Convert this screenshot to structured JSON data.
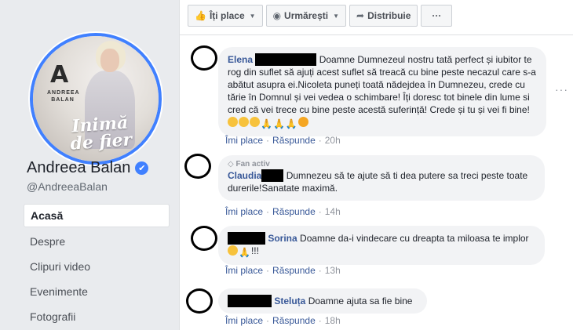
{
  "page": {
    "name": "Andreea Balan",
    "handle": "@AndreeaBalan",
    "cover": {
      "logo_letter": "A",
      "logo_name_line1": "ANDREEA",
      "logo_name_line2": "BALAN",
      "album_title_line1": "Inimă",
      "album_title_line2": "de fier"
    },
    "verified_icon": "✔"
  },
  "nav": {
    "items": [
      {
        "label": "Acasă",
        "active": true
      },
      {
        "label": "Despre"
      },
      {
        "label": "Clipuri video"
      },
      {
        "label": "Evenimente"
      },
      {
        "label": "Fotografii"
      }
    ]
  },
  "actions": {
    "like_label": "Îți place",
    "follow_label": "Urmărești",
    "share_label": "Distribuie",
    "more_label": "···"
  },
  "comments": [
    {
      "author": "Elena",
      "text_line1": "Doamne Dumnezeul nostru tată perfect și",
      "text_rest": "iubitor te rog din suflet să ajuți acest suflet să treacă cu bine peste necazul care s-a abătut asupra ei.Nicoleta puneți toată nădejdea în Dumnezeu, crede cu tărie în Domnul și vei vedea o schimbare! Îți doresc tot binele din lume si cred că vei trece cu bine peste acestă suferință! Crede și tu și vei fi bine!",
      "like": "Îmi place",
      "reply": "Răspunde",
      "time": "20h"
    },
    {
      "badge": "Fan activ",
      "author": "Claudia",
      "text_line1": "Dumnezeu să te ajute să ti dea putere sa treci peste",
      "text_rest": "toate durerile!Sanatate maximă.",
      "like": "Îmi place",
      "reply": "Răspunde",
      "time": "14h"
    },
    {
      "author": "Sorina",
      "text_line1": "Doamne da-i vindecare cu dreapta ta miloasa te",
      "text_rest": "implor",
      "text_end": "!!!",
      "like": "Îmi place",
      "reply": "Răspunde",
      "time": "13h"
    },
    {
      "author": "Steluța",
      "text_line1": "Doamne ajuta sa fie bine",
      "like": "Îmi place",
      "reply": "Răspunde",
      "time": "18h"
    }
  ],
  "colors": {
    "link": "#385898",
    "verified": "#4080ff",
    "bubble": "#f2f3f5"
  }
}
